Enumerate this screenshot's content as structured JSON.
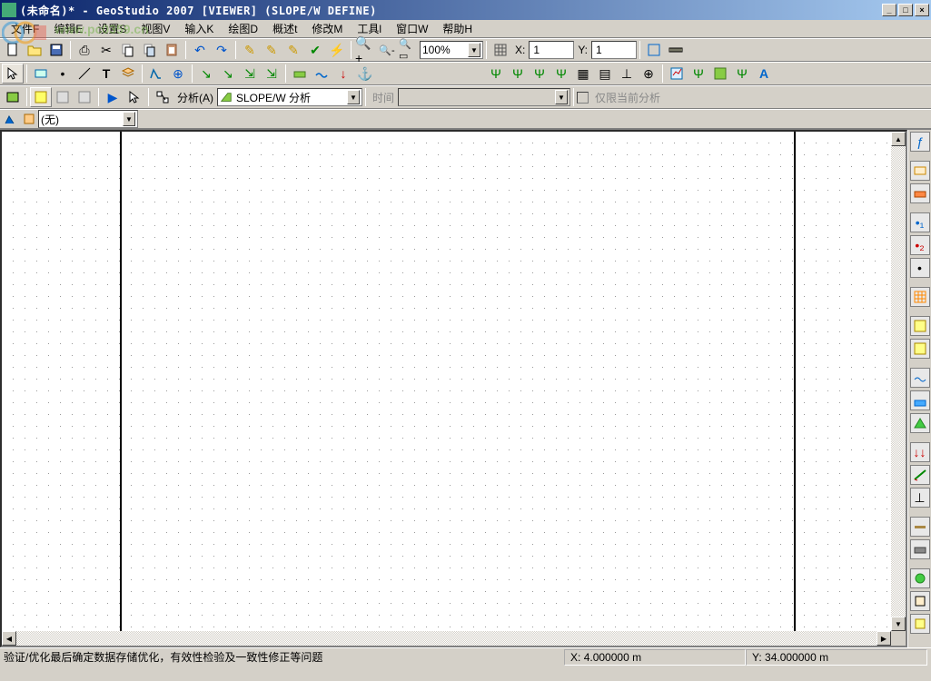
{
  "window": {
    "title": "(未命名)* - GeoStudio 2007 [VIEWER] (SLOPE/W DEFINE)",
    "min": "_",
    "max": "□",
    "close": "×"
  },
  "menu": {
    "file": "文件F",
    "edit": "编辑E",
    "setup": "设置S",
    "view": "视图V",
    "input": "输入K",
    "draw": "绘图D",
    "desc": "概述t",
    "modify": "修改M",
    "tools": "工具l",
    "window": "窗口W",
    "help": "帮助H"
  },
  "watermark": "www.pc0359.cn",
  "toolbar": {
    "zoom": "100%",
    "x_label": "X:",
    "x_value": "1",
    "y_label": "Y:",
    "y_value": "1",
    "analysis_label": "分析(A)",
    "analysis_combo": "SLOPE/W 分析",
    "time_label": "时间",
    "time_value": "",
    "current_only": "仅限当前分析",
    "layer_none": "(无)"
  },
  "status": {
    "msg": "验证/优化最后确定数据存储优化，有效性检验及一致性修正等问题",
    "x_label": "X:",
    "x_value": "4.000000 m",
    "y_label": "Y:",
    "y_value": "34.000000 m"
  },
  "icons": {
    "new": "new-icon",
    "open": "open-icon",
    "save": "save-icon",
    "cut": "cut-icon",
    "copy": "copy-icon",
    "paste": "paste-icon",
    "undo": "undo-icon",
    "redo": "redo-icon",
    "print": "print-icon"
  },
  "rightbar_count": 22
}
